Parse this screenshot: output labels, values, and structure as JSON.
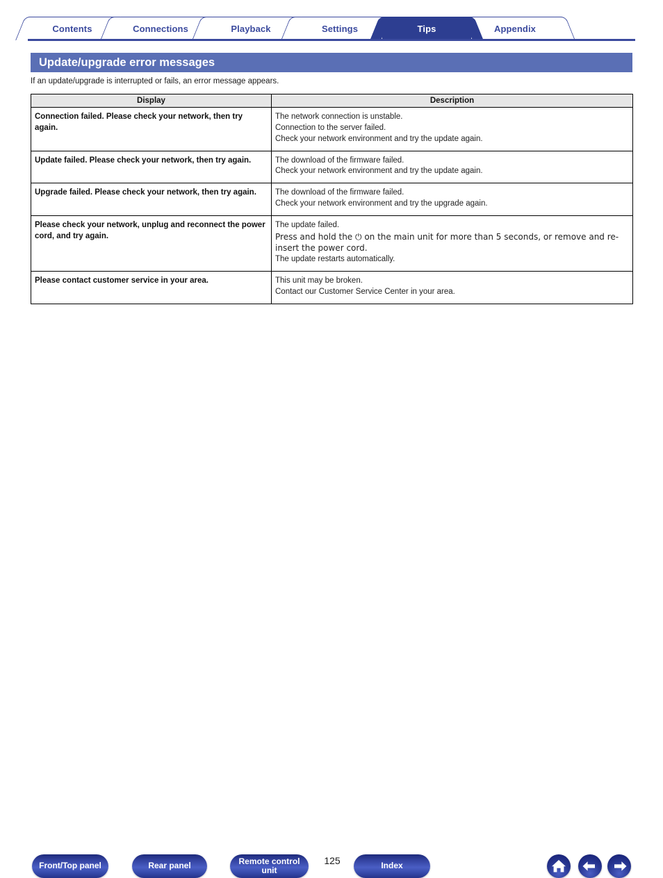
{
  "nav": {
    "tabs": [
      {
        "label": "Contents",
        "active": false
      },
      {
        "label": "Connections",
        "active": false
      },
      {
        "label": "Playback",
        "active": false
      },
      {
        "label": "Settings",
        "active": false
      },
      {
        "label": "Tips",
        "active": true
      },
      {
        "label": "Appendix",
        "active": false
      }
    ]
  },
  "page": {
    "title": "Update/upgrade error messages",
    "intro": "If an update/upgrade is interrupted or fails, an error message appears.",
    "number": "125"
  },
  "table": {
    "headers": [
      "Display",
      "Description"
    ],
    "rows": [
      {
        "display": "Connection failed. Please check your network, then try again.",
        "description": [
          "The network connection is unstable.",
          "Connection to the server failed.",
          "Check your network environment and try the update again."
        ]
      },
      {
        "display": "Update failed. Please check your network, then try again.",
        "description": [
          "The download of the firmware failed.",
          "Check your network environment and try the update again."
        ]
      },
      {
        "display": "Upgrade failed. Please check your network, then try again.",
        "description": [
          "The download of the firmware failed.",
          "Check your network environment and try the upgrade again."
        ]
      },
      {
        "display": "Please check your network, unplug and reconnect the power cord, and try again.",
        "description": [
          "The update failed.",
          "Press and hold the ⏻ on the main unit for more than 5 seconds, or remove and re-insert the power cord.",
          "The update restarts automatically."
        ]
      },
      {
        "display": "Please contact customer service in your area.",
        "description": [
          "This unit may be broken.",
          "Contact our Customer Service Center in your area."
        ]
      }
    ]
  },
  "footer": {
    "buttons": [
      {
        "label": "Front/Top panel",
        "id": "btn-front"
      },
      {
        "label": "Rear panel",
        "id": "btn-rear"
      },
      {
        "label": "Remote control unit",
        "id": "btn-remote"
      },
      {
        "label": "Index",
        "id": "btn-index"
      }
    ],
    "icons": [
      "home-icon",
      "arrow-left-icon",
      "arrow-right-icon"
    ]
  },
  "colors": {
    "tab_active_bg": "#2d3e91",
    "tab_text": "#3b4a9e",
    "title_bar_bg": "#5a6fb5",
    "table_header_bg": "#e6e6e6",
    "button_blue": "#31409c"
  }
}
